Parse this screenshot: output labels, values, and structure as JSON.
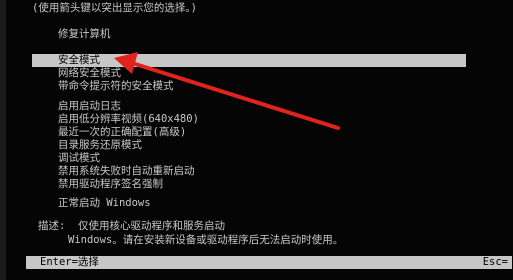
{
  "hint": "(使用箭头键以突出显示您的选择。)",
  "menu": {
    "repair": "修复计算机",
    "items": [
      {
        "label": "安全模式",
        "selected": true
      },
      {
        "label": "网络安全模式"
      },
      {
        "label": "带命令提示符的安全模式"
      },
      {
        "label": "启用启动日志"
      },
      {
        "label": "启用低分辨率视频(640x480)"
      },
      {
        "label": "最近一次的正确配置(高级)"
      },
      {
        "label": "目录服务还原模式"
      },
      {
        "label": "调试模式"
      },
      {
        "label": "禁用系统失败时自动重新启动"
      },
      {
        "label": "禁用驱动程序签名强制"
      },
      {
        "label": "正常启动 Windows"
      }
    ]
  },
  "description": {
    "label": "描述:",
    "line1": "仅使用核心驱动程序和服务启动",
    "line2": "Windows。请在安装新设备或驱动程序后无法启动时使用。"
  },
  "footer": {
    "left": "Enter=选择",
    "right": "Esc="
  },
  "colors": {
    "background": "#050505",
    "text": "#c8c8c8",
    "highlight": "#c7c7c7",
    "arrow": "#e0241b"
  }
}
